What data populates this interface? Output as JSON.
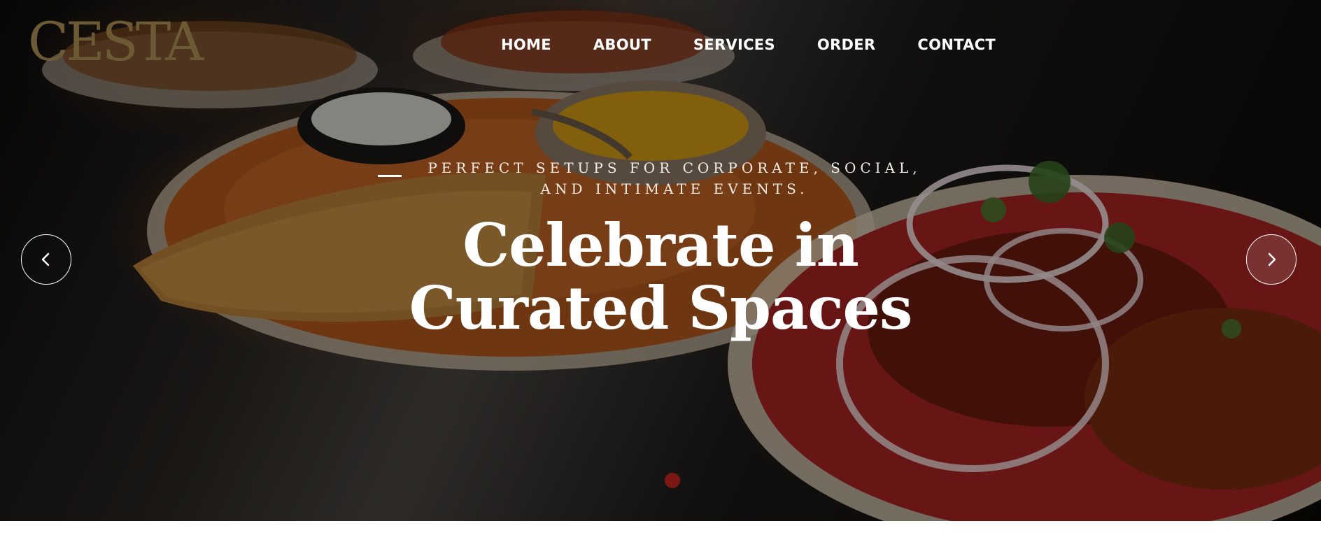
{
  "brand": {
    "logo_text": "CESTA",
    "logo_color": "#6b5a33"
  },
  "nav": {
    "items": [
      {
        "label": "HOME"
      },
      {
        "label": "ABOUT"
      },
      {
        "label": "SERVICES"
      },
      {
        "label": "ORDER"
      },
      {
        "label": "CONTACT"
      }
    ]
  },
  "hero": {
    "tagline": "PERFECT SETUPS FOR CORPORATE, SOCIAL, AND INTIMATE EVENTS.",
    "headline_line1": "Celebrate in",
    "headline_line2": "Curated Spaces",
    "prev_icon": "chevron-left-icon",
    "next_icon": "chevron-right-icon",
    "dot_color": "#7b1813",
    "active_slide": 1
  }
}
